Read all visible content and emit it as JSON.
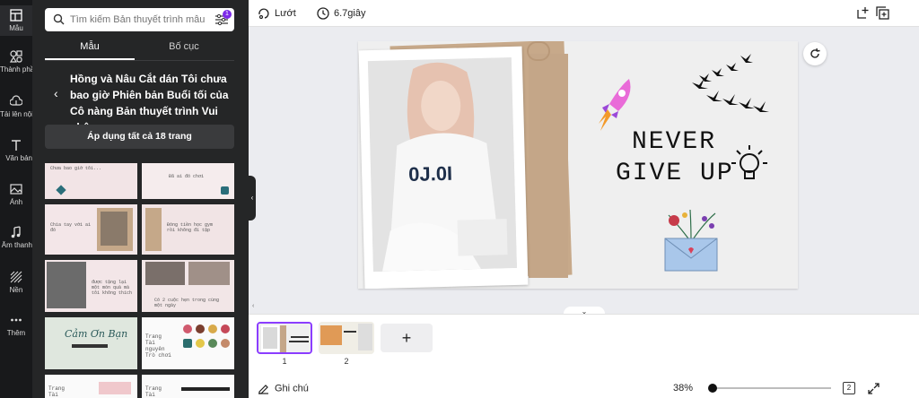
{
  "rail": {
    "items": [
      {
        "label": "Mẫu",
        "icon": "layout-icon"
      },
      {
        "label": "Thành phần",
        "icon": "elements-icon"
      },
      {
        "label": "Tải lên nội dung",
        "icon": "upload-cloud-icon"
      },
      {
        "label": "Văn bản",
        "icon": "text-icon"
      },
      {
        "label": "Ảnh",
        "icon": "photo-icon"
      },
      {
        "label": "Âm thanh",
        "icon": "music-icon"
      },
      {
        "label": "Nền",
        "icon": "background-icon"
      },
      {
        "label": "Thêm",
        "icon": "more-icon"
      }
    ]
  },
  "panel": {
    "search_placeholder": "Tìm kiếm Bản thuyết trình mẫu",
    "filter_badge": "1",
    "tabs": [
      "Mẫu",
      "Bố cục"
    ],
    "template_title": "Hồng và Nâu Cắt dán Tôi chưa bao giờ Phiên bản Buổi tối của Cô nàng Bản thuyết trình Vui nhộn",
    "apply_label": "Áp dụng tất cả 18 trang",
    "thumb_texts": [
      "Chưa bao giờ tôi...",
      "Đã ai đó chơi",
      "Chia tay với ai đó",
      "Đóng tiền học gym rồi không đi tập",
      "được tặng lại một món quà mà tôi không thích",
      "Có 2 cuộc hẹn trong cùng một ngày",
      "Cảm Ơn Bạn",
      "Trang Tài nguyên Trò chơi",
      "Trang Tài nguyên",
      "Trang Tài nguyên"
    ]
  },
  "topbar": {
    "glide_label": "Lướt",
    "timer_label": "6.7giây"
  },
  "slide": {
    "line1": "NEVER",
    "line2": "GIVE UP"
  },
  "pages": {
    "items": [
      {
        "number": "1"
      },
      {
        "number": "2"
      }
    ],
    "add_label": "+"
  },
  "bottombar": {
    "notes_label": "Ghi chú",
    "zoom_label": "38%",
    "zoom_level": 0.0,
    "page_count": "2"
  },
  "colors": {
    "accent": "#8b3dff",
    "panel_bg": "#252627",
    "rail_bg": "#18191b"
  }
}
